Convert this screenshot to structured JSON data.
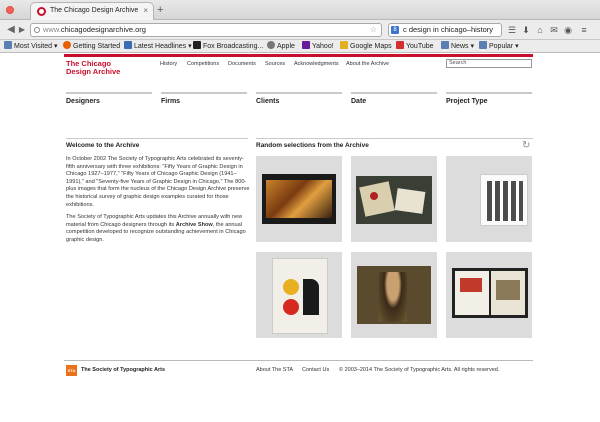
{
  "browser": {
    "tab_title": "The Chicago Design Archive",
    "tab_close": "×",
    "new_tab": "+",
    "url_prefix": "www.",
    "url_host": "chicagodesignarchive.org",
    "search_value": "c design in chicago–history",
    "bookmarks": [
      {
        "label": "Most Visited ▾",
        "color": "#5b7fb3"
      },
      {
        "label": "Getting Started",
        "color": "#e66000"
      },
      {
        "label": "Latest Headlines ▾",
        "color": "#3b6bb5"
      },
      {
        "label": "Fox Broadcasting...",
        "color": "#222222"
      },
      {
        "label": "Apple",
        "color": "#777777"
      },
      {
        "label": "Yahoo!",
        "color": "#6a1b9a"
      },
      {
        "label": "Google Maps",
        "color": "#e0b020"
      },
      {
        "label": "YouTube",
        "color": "#d32f2f"
      },
      {
        "label": "News ▾",
        "color": "#5b7fb3"
      },
      {
        "label": "Popular ▾",
        "color": "#5b7fb3"
      }
    ]
  },
  "site": {
    "logo_line1": "The Chicago",
    "logo_line2": "Design Archive",
    "nav": [
      "History",
      "Competitions",
      "Documents",
      "Sources",
      "Acknowledgments",
      "About the Archive"
    ],
    "search_placeholder": "Search",
    "facets": [
      "Designers",
      "Firms",
      "Clients",
      "Date",
      "Project Type"
    ],
    "welcome_title": "Welcome to the Archive",
    "intro_p1": "In October 2002 The Society of Typographic Arts celebrated its seventy-fifth anniversary with three exhibitions: \"Fifty Years of Graphic Design in Chicago 1927–1977,\" \"Fifty Years of Chicago Graphic Design (1941–1991),\" and \"Seventy-five Years of Graphic Design in Chicago.\" The 800-plus images that form the nucleus of the Chicago Design Archive preserve the historical survey of graphic design examples curated for those exhibitions.",
    "intro_p2_a": "The Society of Typographic Arts updates this Archive annually with new material from Chicago designers through its ",
    "intro_p2_link": "Archive Show",
    "intro_p2_b": ", the annual competition developed to recognize outstanding achievement in Chicago graphic design.",
    "random_title": "Random selections from the Archive",
    "refresh_icon": "refresh-icon",
    "footer": {
      "sta_logo": "STA",
      "sta_name": "The Society of Typographic Arts",
      "about": "About The STA",
      "contact": "Contact Us",
      "copyright": "© 2003–2014 The Society of Typographic Arts. All rights reserved."
    }
  }
}
